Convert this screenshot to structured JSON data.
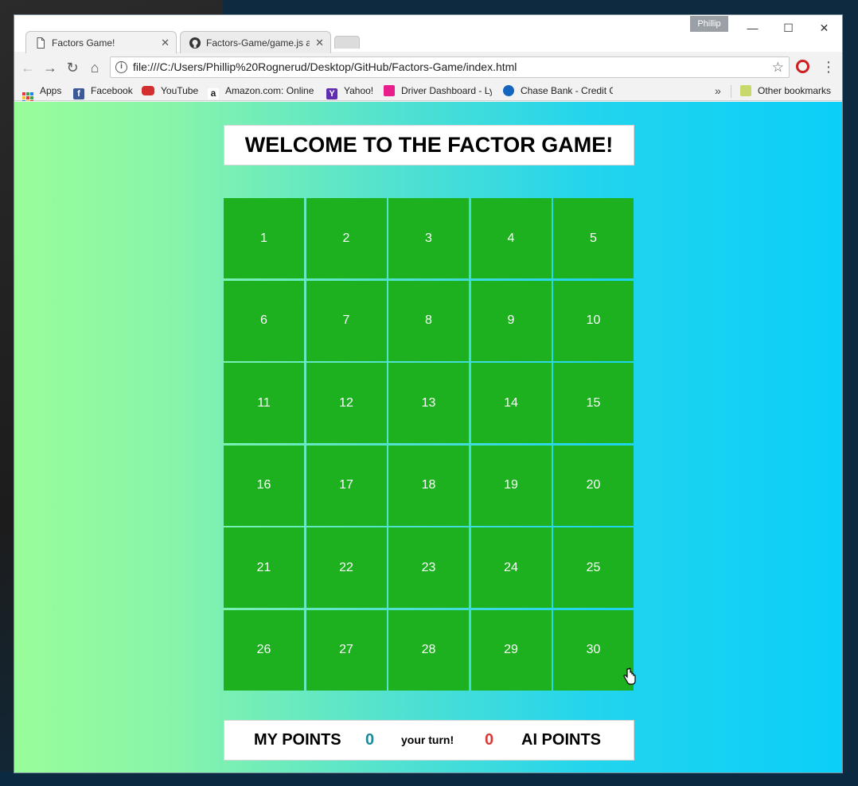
{
  "browser": {
    "profile_name": "Phillip",
    "tabs": [
      {
        "title": "Factors Game!",
        "active": true
      },
      {
        "title": "Factors-Game/game.js at",
        "active": false
      }
    ],
    "url": "file:///C:/Users/Phillip%20Rognerud/Desktop/GitHub/Factors-Game/index.html",
    "bookmarks": [
      {
        "label": "Apps",
        "icon": "apps-icon"
      },
      {
        "label": "Facebook",
        "icon": "facebook-icon"
      },
      {
        "label": "YouTube",
        "icon": "youtube-icon"
      },
      {
        "label": "Amazon.com: Online",
        "icon": "amazon-icon"
      },
      {
        "label": "Yahoo!",
        "icon": "yahoo-icon"
      },
      {
        "label": "Driver Dashboard - Ly",
        "icon": "lyft-icon"
      },
      {
        "label": "Chase Bank - Credit C",
        "icon": "chase-icon"
      }
    ],
    "bookmarks_overflow": "»",
    "other_bookmarks": "Other bookmarks"
  },
  "game": {
    "title": "WELCOME TO THE FACTOR GAME!",
    "numbers": [
      "1",
      "2",
      "3",
      "4",
      "5",
      "6",
      "7",
      "8",
      "9",
      "10",
      "11",
      "12",
      "13",
      "14",
      "15",
      "16",
      "17",
      "18",
      "19",
      "20",
      "21",
      "22",
      "23",
      "24",
      "25",
      "26",
      "27",
      "28",
      "29",
      "30"
    ],
    "cell_color": "#1db11f",
    "scoreboard": {
      "my_label": "MY POINTS",
      "my_score": "0",
      "my_score_color": "#1a8a9c",
      "turn_text": "your turn!",
      "ai_score": "0",
      "ai_score_color": "#d63b3b",
      "ai_label": "AI POINTS"
    }
  }
}
